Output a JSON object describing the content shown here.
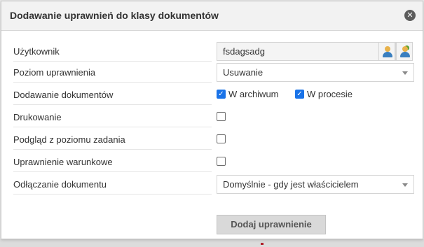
{
  "dialog": {
    "title": "Dodawanie uprawnień do klasy dokumentów",
    "close_icon": "close-circle-icon"
  },
  "rows": {
    "user": {
      "label": "Użytkownik",
      "value": "fsdagsadg",
      "icons": [
        "user-icon",
        "user-group-icon"
      ]
    },
    "permission_level": {
      "label": "Poziom uprawnienia",
      "value": "Usuwanie"
    },
    "adding_documents": {
      "label": "Dodawanie dokumentów",
      "options": [
        {
          "label": "W archiwum",
          "checked": true
        },
        {
          "label": "W procesie",
          "checked": true
        }
      ]
    },
    "printing": {
      "label": "Drukowanie",
      "checked": false
    },
    "preview_from_task": {
      "label": "Podgląd z poziomu zadania",
      "checked": false
    },
    "conditional_permission": {
      "label": "Uprawnienie warunkowe",
      "checked": false
    },
    "detaching_document": {
      "label": "Odłączanie dokumentu",
      "value": "Domyślnie - gdy jest właścicielem"
    }
  },
  "submit": {
    "label": "Dodaj uprawnienie"
  },
  "colors": {
    "checkbox_accent": "#1a73e8",
    "header_bg": "#f2f2f2",
    "button_bg": "#d9d9d9"
  }
}
